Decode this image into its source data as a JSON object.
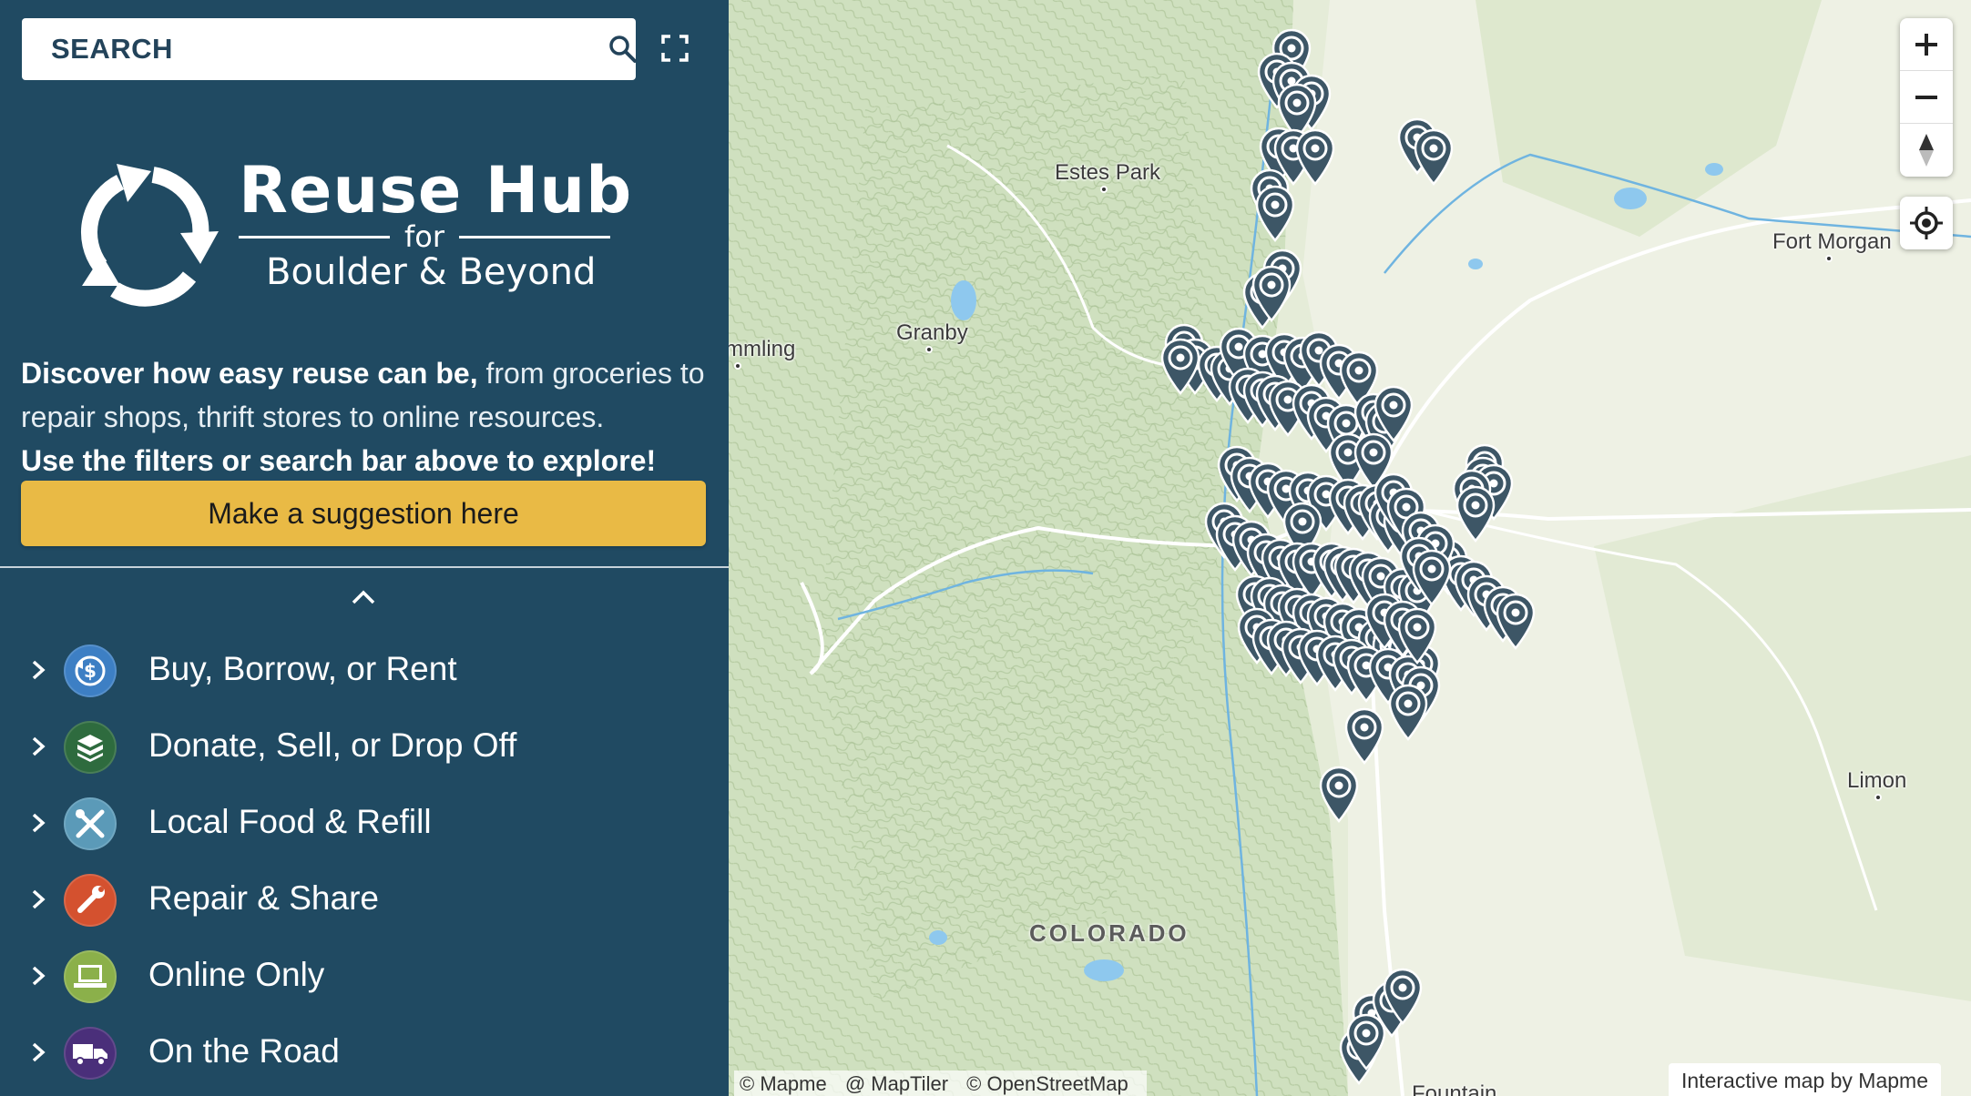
{
  "search": {
    "placeholder": "SEARCH"
  },
  "logo": {
    "title": "Reuse Hub",
    "for": "for",
    "subtitle": "Boulder & Beyond"
  },
  "intro": {
    "bold1": "Discover how easy reuse can be,",
    "normal": " from groceries to repair shops, thrift stores to online resources.",
    "bold2": "Use the filters or search bar above to explore!"
  },
  "suggest_button": "Make a suggestion here",
  "categories": [
    {
      "label": "Buy, Borrow, or Rent",
      "icon": "money-cycle-icon",
      "color": "#3d7fc4"
    },
    {
      "label": "Donate, Sell, or Drop Off",
      "icon": "box-icon",
      "color": "#2e6b3e"
    },
    {
      "label": "Local Food & Refill",
      "icon": "fork-knife-icon",
      "color": "#5b9ab8"
    },
    {
      "label": "Repair & Share",
      "icon": "wrench-icon",
      "color": "#d4512f"
    },
    {
      "label": "Online Only",
      "icon": "laptop-icon",
      "color": "#8bb04a"
    },
    {
      "label": "On the Road",
      "icon": "truck-icon",
      "color": "#4a2f7a"
    }
  ],
  "map": {
    "places": [
      "Estes Park",
      "Granby",
      "mmling",
      "Fort Morgan",
      "Limon",
      "Fountain"
    ],
    "state": "COLORADO",
    "attribution": [
      "© Mapme",
      "@ MapTiler",
      "© OpenStreetMap"
    ],
    "badge": "Interactive map by Mapme",
    "pin_color": "#3d5666"
  }
}
